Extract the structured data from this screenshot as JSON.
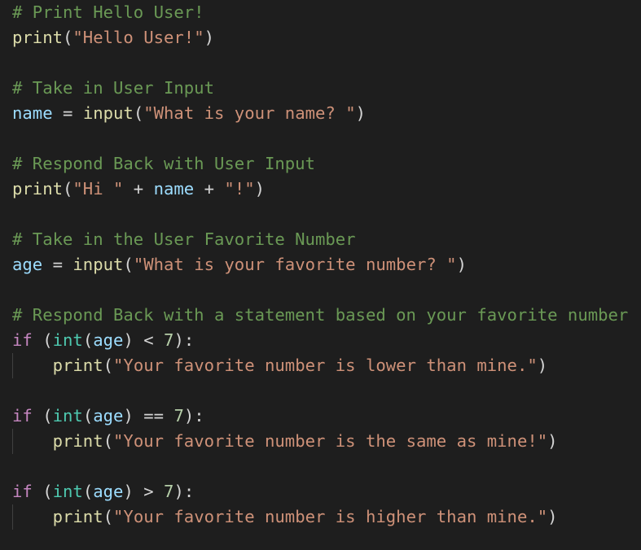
{
  "editor": {
    "colors": {
      "background": "#1e1e1e",
      "comment": "#6a9955",
      "function": "#dcdcaa",
      "string": "#ce9178",
      "variable": "#9cdcfe",
      "keyword": "#c586c0",
      "builtin_type": "#4ec9b0",
      "number": "#b5cea8",
      "operator": "#d4d4d4",
      "indent_guide": "#404040"
    },
    "lines": [
      {
        "tokens": [
          {
            "t": "comment",
            "v": "# Print Hello User!"
          }
        ]
      },
      {
        "tokens": [
          {
            "t": "func",
            "v": "print"
          },
          {
            "t": "punct",
            "v": "("
          },
          {
            "t": "string",
            "v": "\"Hello User!\""
          },
          {
            "t": "punct",
            "v": ")"
          }
        ]
      },
      {
        "tokens": []
      },
      {
        "tokens": [
          {
            "t": "comment",
            "v": "# Take in User Input"
          }
        ]
      },
      {
        "tokens": [
          {
            "t": "var",
            "v": "name"
          },
          {
            "t": "op",
            "v": " = "
          },
          {
            "t": "func",
            "v": "input"
          },
          {
            "t": "punct",
            "v": "("
          },
          {
            "t": "string",
            "v": "\"What is your name? \""
          },
          {
            "t": "punct",
            "v": ")"
          }
        ]
      },
      {
        "tokens": []
      },
      {
        "tokens": [
          {
            "t": "comment",
            "v": "# Respond Back with User Input"
          }
        ]
      },
      {
        "tokens": [
          {
            "t": "func",
            "v": "print"
          },
          {
            "t": "punct",
            "v": "("
          },
          {
            "t": "string",
            "v": "\"Hi \""
          },
          {
            "t": "op",
            "v": " + "
          },
          {
            "t": "var",
            "v": "name"
          },
          {
            "t": "op",
            "v": " + "
          },
          {
            "t": "string",
            "v": "\"!\""
          },
          {
            "t": "punct",
            "v": ")"
          }
        ]
      },
      {
        "tokens": []
      },
      {
        "tokens": [
          {
            "t": "comment",
            "v": "# Take in the User Favorite Number"
          }
        ]
      },
      {
        "tokens": [
          {
            "t": "var",
            "v": "age"
          },
          {
            "t": "op",
            "v": " = "
          },
          {
            "t": "func",
            "v": "input"
          },
          {
            "t": "punct",
            "v": "("
          },
          {
            "t": "string",
            "v": "\"What is your favorite number? \""
          },
          {
            "t": "punct",
            "v": ")"
          }
        ]
      },
      {
        "tokens": []
      },
      {
        "tokens": [
          {
            "t": "comment",
            "v": "# Respond Back with a statement based on your favorite number"
          }
        ]
      },
      {
        "tokens": [
          {
            "t": "keyword",
            "v": "if"
          },
          {
            "t": "op",
            "v": " "
          },
          {
            "t": "punct",
            "v": "("
          },
          {
            "t": "type",
            "v": "int"
          },
          {
            "t": "punct",
            "v": "("
          },
          {
            "t": "var",
            "v": "age"
          },
          {
            "t": "punct",
            "v": ")"
          },
          {
            "t": "op",
            "v": " < "
          },
          {
            "t": "number",
            "v": "7"
          },
          {
            "t": "punct",
            "v": "):"
          }
        ]
      },
      {
        "indent": true,
        "tokens": [
          {
            "t": "op",
            "v": "    "
          },
          {
            "t": "func",
            "v": "print"
          },
          {
            "t": "punct",
            "v": "("
          },
          {
            "t": "string",
            "v": "\"Your favorite number is lower than mine.\""
          },
          {
            "t": "punct",
            "v": ")"
          }
        ]
      },
      {
        "tokens": []
      },
      {
        "tokens": [
          {
            "t": "keyword",
            "v": "if"
          },
          {
            "t": "op",
            "v": " "
          },
          {
            "t": "punct",
            "v": "("
          },
          {
            "t": "type",
            "v": "int"
          },
          {
            "t": "punct",
            "v": "("
          },
          {
            "t": "var",
            "v": "age"
          },
          {
            "t": "punct",
            "v": ")"
          },
          {
            "t": "op",
            "v": " == "
          },
          {
            "t": "number",
            "v": "7"
          },
          {
            "t": "punct",
            "v": "):"
          }
        ]
      },
      {
        "indent": true,
        "tokens": [
          {
            "t": "op",
            "v": "    "
          },
          {
            "t": "func",
            "v": "print"
          },
          {
            "t": "punct",
            "v": "("
          },
          {
            "t": "string",
            "v": "\"Your favorite number is the same as mine!\""
          },
          {
            "t": "punct",
            "v": ")"
          }
        ]
      },
      {
        "tokens": []
      },
      {
        "tokens": [
          {
            "t": "keyword",
            "v": "if"
          },
          {
            "t": "op",
            "v": " "
          },
          {
            "t": "punct",
            "v": "("
          },
          {
            "t": "type",
            "v": "int"
          },
          {
            "t": "punct",
            "v": "("
          },
          {
            "t": "var",
            "v": "age"
          },
          {
            "t": "punct",
            "v": ")"
          },
          {
            "t": "op",
            "v": " > "
          },
          {
            "t": "number",
            "v": "7"
          },
          {
            "t": "punct",
            "v": "):"
          }
        ]
      },
      {
        "indent": true,
        "tokens": [
          {
            "t": "op",
            "v": "    "
          },
          {
            "t": "func",
            "v": "print"
          },
          {
            "t": "punct",
            "v": "("
          },
          {
            "t": "string",
            "v": "\"Your favorite number is higher than mine.\""
          },
          {
            "t": "punct",
            "v": ")"
          }
        ]
      }
    ]
  }
}
